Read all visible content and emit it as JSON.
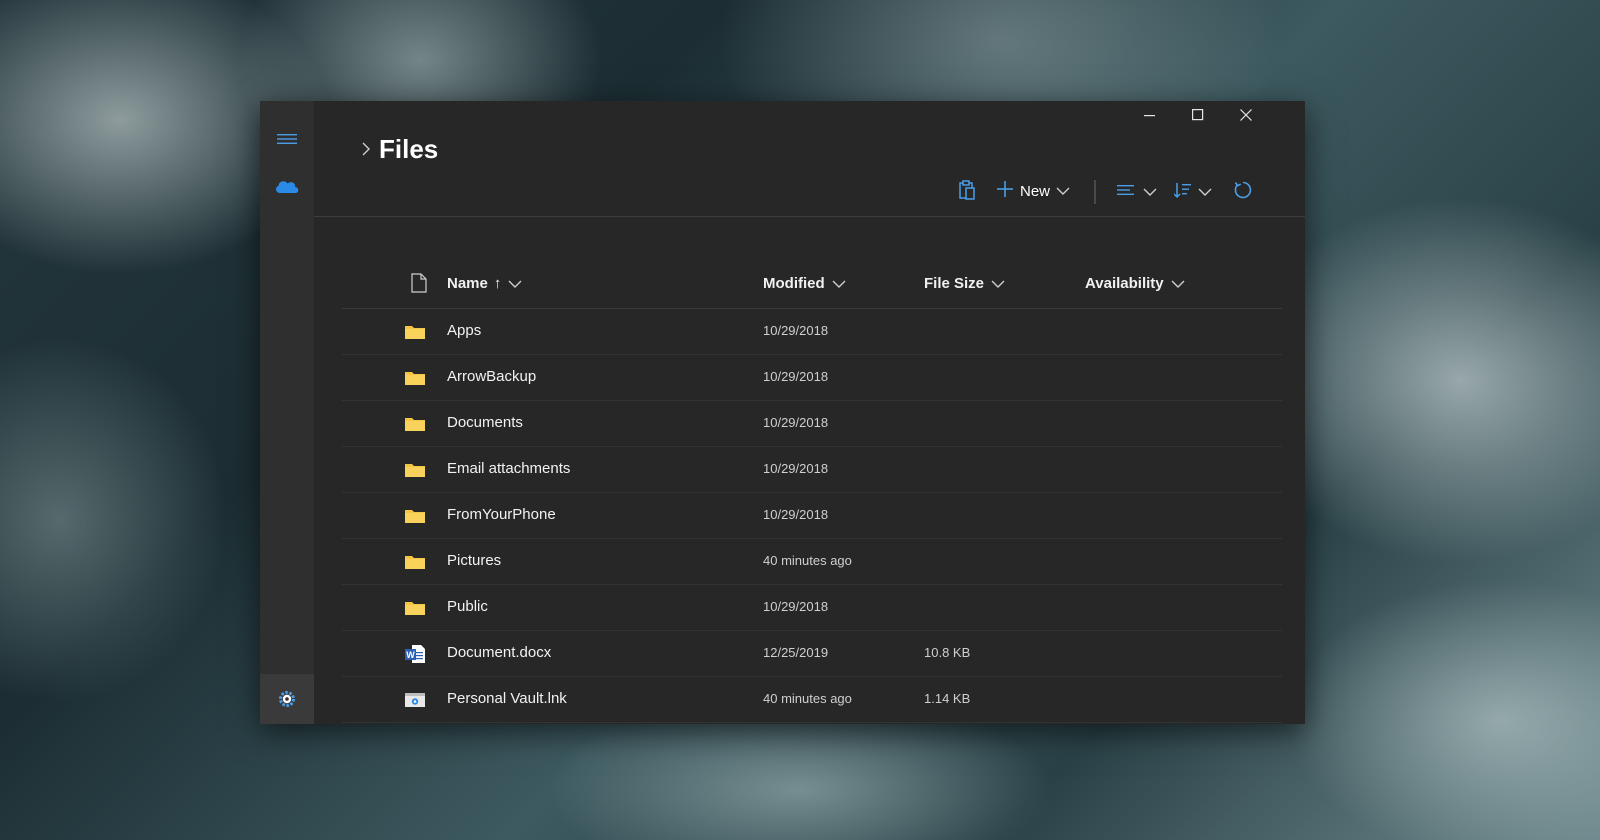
{
  "window": {
    "title": "Files",
    "controls": {
      "minimize": "minimize",
      "maximize": "maximize",
      "close": "close"
    }
  },
  "sidebar": {
    "items": [
      {
        "icon": "hamburger-menu-icon"
      },
      {
        "icon": "onedrive-cloud-icon",
        "accent": "#2a8ae6"
      },
      {
        "icon": "settings-gear-icon"
      }
    ]
  },
  "toolbar": {
    "paste_icon": "paste-icon",
    "new_label": "New",
    "view_icon": "view-options-icon",
    "sort_icon": "sort-icon",
    "refresh_icon": "refresh-icon",
    "accent": "#4a9ee8"
  },
  "table": {
    "columns": {
      "name": "Name",
      "sort_arrow": "↑",
      "modified": "Modified",
      "size": "File Size",
      "availability": "Availability"
    },
    "rows": [
      {
        "type": "folder",
        "name": "Apps",
        "modified": "10/29/2018",
        "size": ""
      },
      {
        "type": "folder",
        "name": "ArrowBackup",
        "modified": "10/29/2018",
        "size": ""
      },
      {
        "type": "folder",
        "name": "Documents",
        "modified": "10/29/2018",
        "size": ""
      },
      {
        "type": "folder",
        "name": "Email attachments",
        "modified": "10/29/2018",
        "size": ""
      },
      {
        "type": "folder",
        "name": "FromYourPhone",
        "modified": "10/29/2018",
        "size": ""
      },
      {
        "type": "folder",
        "name": "Pictures",
        "modified": "40 minutes ago",
        "size": ""
      },
      {
        "type": "folder",
        "name": "Public",
        "modified": "10/29/2018",
        "size": ""
      },
      {
        "type": "word",
        "name": "Document.docx",
        "modified": "12/25/2019",
        "size": "10.8 KB"
      },
      {
        "type": "link",
        "name": "Personal Vault.lnk",
        "modified": "40 minutes ago",
        "size": "1.14 KB"
      }
    ]
  },
  "colors": {
    "folder": "#f4c542",
    "word": "#2b5fb4",
    "window_bg": "#272727",
    "sidebar_bg": "#2f2f2f"
  }
}
